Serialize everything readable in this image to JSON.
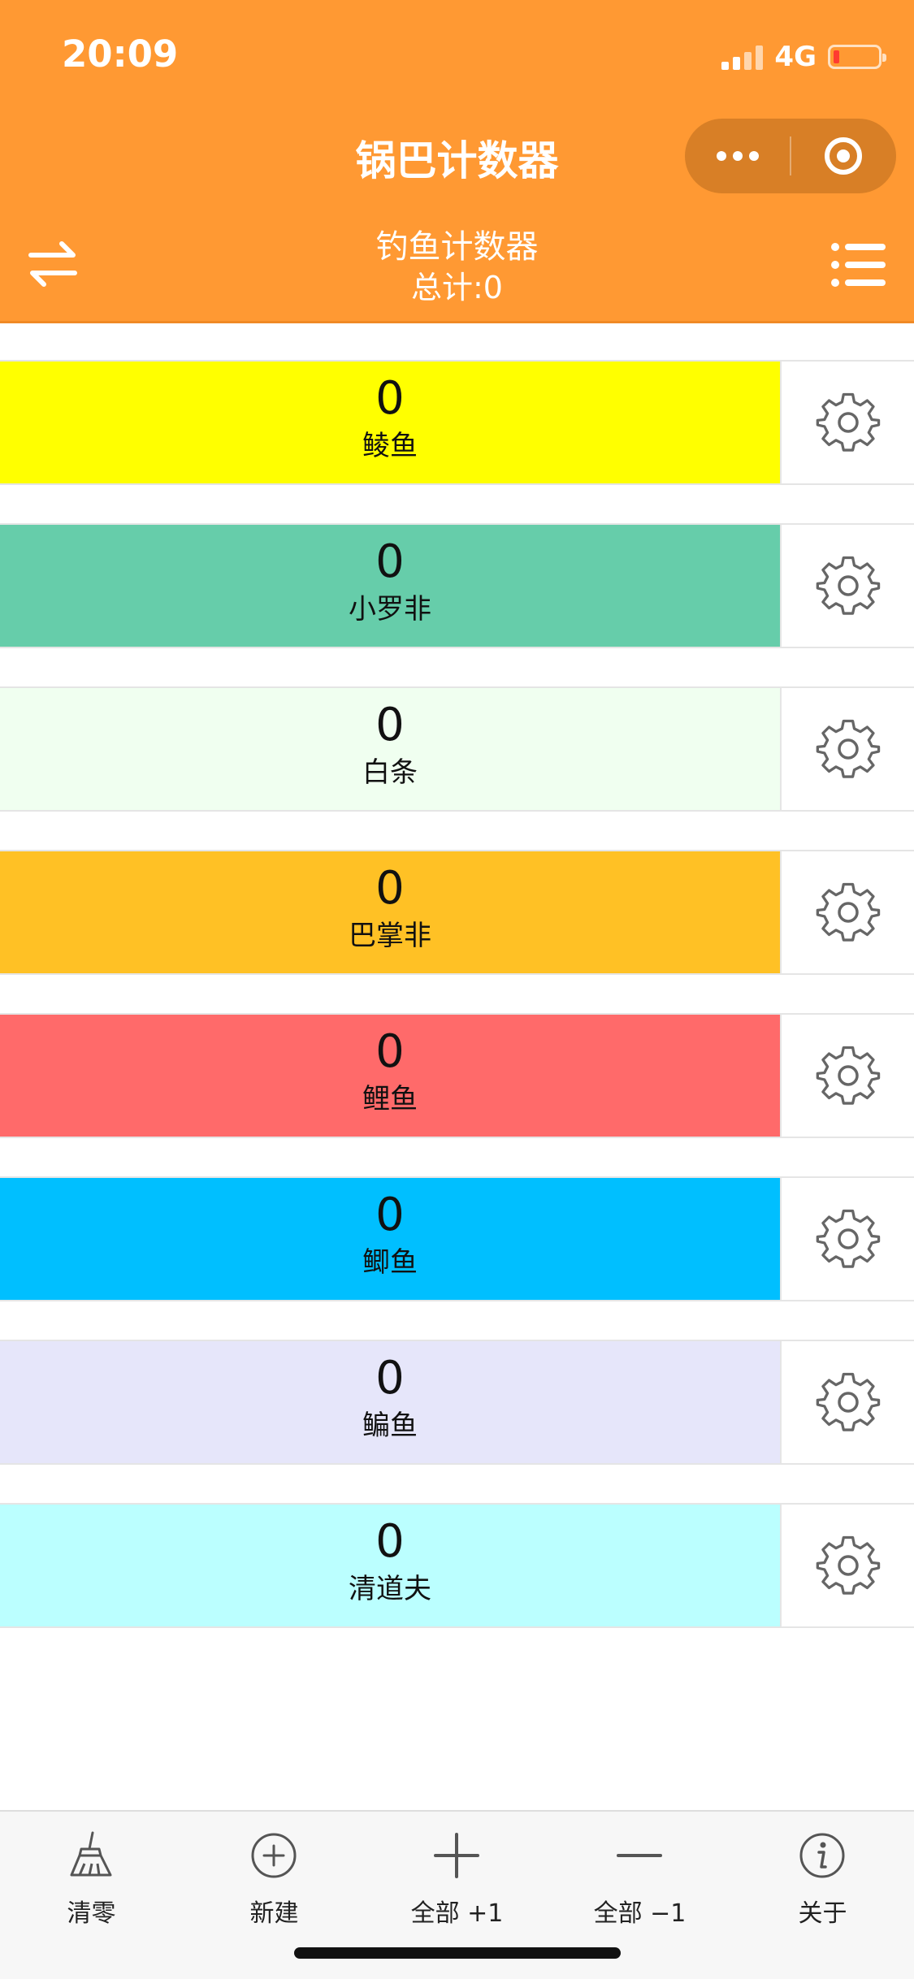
{
  "status_bar": {
    "time": "20:09",
    "network": "4G"
  },
  "nav": {
    "title": "锅巴计数器"
  },
  "header": {
    "subtitle": "钓鱼计数器",
    "total_label": "总计:0"
  },
  "counters": [
    {
      "count": "0",
      "name": "鲮鱼",
      "color": "#FFFF00"
    },
    {
      "count": "0",
      "name": "小罗非",
      "color": "#66CDAA"
    },
    {
      "count": "0",
      "name": "白条",
      "color": "#F0FFF0"
    },
    {
      "count": "0",
      "name": "巴掌非",
      "color": "#FFC125"
    },
    {
      "count": "0",
      "name": "鲤鱼",
      "color": "#FF6A6A"
    },
    {
      "count": "0",
      "name": "鲫鱼",
      "color": "#00BFFF"
    },
    {
      "count": "0",
      "name": "鳊鱼",
      "color": "#E6E6FA"
    },
    {
      "count": "0",
      "name": "清道夫",
      "color": "#BBFFFF"
    }
  ],
  "tabbar": {
    "reset": "清零",
    "new": "新建",
    "all_plus": "全部 +1",
    "all_minus": "全部 −1",
    "about": "关于"
  },
  "icons": [
    "swap-icon",
    "menu-list-icon",
    "more-icon",
    "close-target-icon",
    "gear-icon",
    "broom-icon",
    "plus-circle-icon",
    "plus-icon",
    "minus-icon",
    "info-icon"
  ],
  "colors": {
    "header": "#FF9933",
    "capsule": "#D87F26"
  }
}
